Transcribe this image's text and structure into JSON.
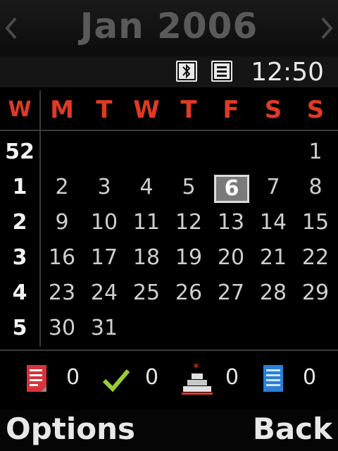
{
  "header": {
    "title": "Jan 2006"
  },
  "status": {
    "time": "12:50"
  },
  "calendar": {
    "week_header": "W",
    "weekdays": [
      "M",
      "T",
      "W",
      "T",
      "F",
      "S",
      "S"
    ],
    "weeks": [
      "52",
      "1",
      "2",
      "3",
      "4",
      "5"
    ],
    "rows": [
      [
        "",
        "",
        "",
        "",
        "",
        "",
        "1"
      ],
      [
        "2",
        "3",
        "4",
        "5",
        "6",
        "7",
        "8"
      ],
      [
        "9",
        "10",
        "11",
        "12",
        "13",
        "14",
        "15"
      ],
      [
        "16",
        "17",
        "18",
        "19",
        "20",
        "21",
        "22"
      ],
      [
        "23",
        "24",
        "25",
        "26",
        "27",
        "28",
        "29"
      ],
      [
        "30",
        "31",
        "",
        "",
        "",
        "",
        ""
      ]
    ],
    "selected_day": "6"
  },
  "indicators": [
    {
      "icon": "memo-icon",
      "count": "0"
    },
    {
      "icon": "task-check-icon",
      "count": "0"
    },
    {
      "icon": "anniversary-cake-icon",
      "count": "0"
    },
    {
      "icon": "notes-icon",
      "count": "0"
    }
  ],
  "softkeys": {
    "left": "Options",
    "right": "Back"
  },
  "colors": {
    "weekday_header": "#e03a24",
    "background": "#000000"
  }
}
